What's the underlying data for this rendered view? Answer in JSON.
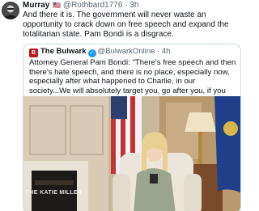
{
  "tweet": {
    "display_name": "Murray",
    "flag": "🇺🇸",
    "handle": "@Rothbard1776",
    "time": "3h",
    "text": "And there it is. The government will never waste an opportunity to crack down on free speech and expand the totalitarian state. Pam Bondi is a disgrace."
  },
  "quoted": {
    "display_name": "The Bulwark",
    "handle": "@BulwarkOnline",
    "time": "4h",
    "text": "Attorney General Pam Bondi: \"There's free speech and then there's hate speech, and there is no place, especially now, especially after what happened to Charlie, in our society...We will absolutely target you, go after you, if you are targeting anyone with hate speech.\"",
    "media_watermark": "THE KATIE MILLER"
  },
  "colors": {
    "text": "#0f1419",
    "muted": "#536471",
    "border": "#cfd9de",
    "verified": "#1d9bf0",
    "bulwark_logo": "#b31b1b"
  },
  "icons": {
    "avatar": "avatar-image",
    "verified": "verified-badge-icon",
    "logo": "bulwark-logo-icon"
  }
}
